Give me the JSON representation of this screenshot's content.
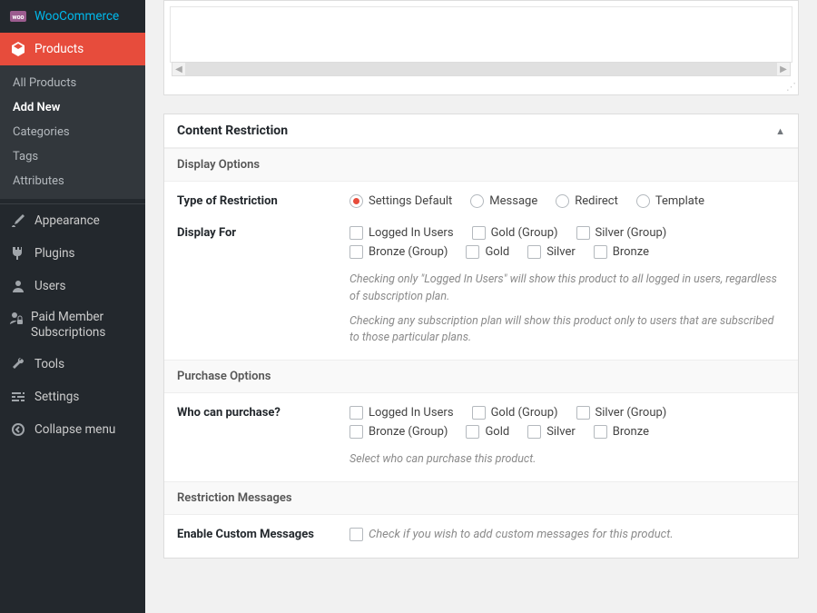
{
  "sidebar": {
    "woocommerce": "WooCommerce",
    "products": "Products",
    "products_sub": [
      "All Products",
      "Add New",
      "Categories",
      "Tags",
      "Attributes"
    ],
    "products_current": "Add New",
    "appearance": "Appearance",
    "plugins": "Plugins",
    "users": "Users",
    "pms": "Paid Member Subscriptions",
    "tools": "Tools",
    "settings": "Settings",
    "collapse": "Collapse menu"
  },
  "panel": {
    "title": "Content Restriction",
    "sections": {
      "display": "Display Options",
      "purchase": "Purchase Options",
      "messages": "Restriction Messages"
    }
  },
  "fields": {
    "type_of_restriction": {
      "label": "Type of Restriction",
      "selected": "Settings Default",
      "options": [
        "Settings Default",
        "Message",
        "Redirect",
        "Template"
      ]
    },
    "display_for": {
      "label": "Display For",
      "options": [
        "Logged In Users",
        "Gold (Group)",
        "Silver (Group)",
        "Bronze (Group)",
        "Gold",
        "Silver",
        "Bronze"
      ],
      "hint1": "Checking only \"Logged In Users\" will show this product to all logged in users, regardless of subscription plan.",
      "hint2": "Checking any subscription plan will show this product only to users that are subscribed to those particular plans."
    },
    "who_can_purchase": {
      "label": "Who can purchase?",
      "options": [
        "Logged In Users",
        "Gold (Group)",
        "Silver (Group)",
        "Bronze (Group)",
        "Gold",
        "Silver",
        "Bronze"
      ],
      "hint": "Select who can purchase this product."
    },
    "enable_custom_messages": {
      "label": "Enable Custom Messages",
      "checkbox_hint": "Check if you wish to add custom messages for this product."
    }
  }
}
